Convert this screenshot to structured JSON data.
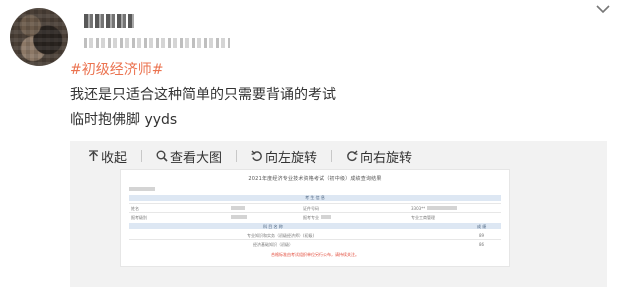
{
  "post": {
    "hashtag": "#初级经济师#",
    "lines": [
      "我还是只适合这种简单的只需要背诵的考试",
      "临时抱佛脚 yyds"
    ]
  },
  "toolbar": {
    "collapse": "收起",
    "view_large": "查看大图",
    "rotate_left": "向左旋转",
    "rotate_right": "向右旋转"
  },
  "document": {
    "title": "2021年度经济专业技术资格考试（初中级）成绩查询结果",
    "section_header": "考 生 信 息",
    "score_header_subject": "科 目 名 称",
    "score_header_score": "成 绩",
    "rows": [
      {
        "label": "姓名",
        "mid_label": "证件号码",
        "mid_value": "3303**"
      },
      {
        "label": "报考级别",
        "mid_label": "报考专业",
        "right_value": "专业工商管理"
      }
    ],
    "subjects": [
      {
        "name": "专业知识和实务（初级经济师）(初级)",
        "score": "89"
      },
      {
        "name": "经济基础知识（初级）",
        "score": "86"
      }
    ],
    "warning": "合格标准由考试组织单位另行公布，请持续关注。"
  },
  "colors": {
    "accent": "#eb7350",
    "panel_bg": "#f2f2f2",
    "text": "#333333"
  },
  "icons": [
    "chevron-down-icon",
    "collapse-arrow-icon",
    "magnifier-icon",
    "rotate-left-icon",
    "rotate-right-icon"
  ]
}
